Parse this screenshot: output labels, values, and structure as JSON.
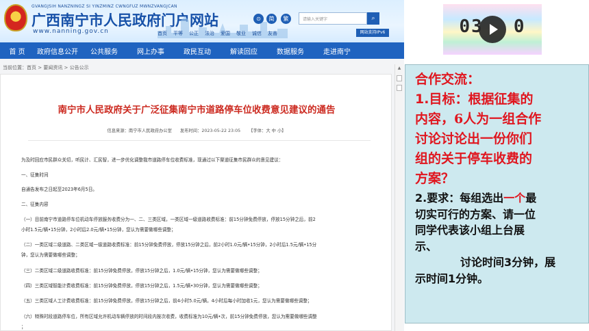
{
  "site": {
    "pinyin": "GVANGJSIH NANZNINGZ SI YINZMINZ CWNGFUZ MWNZVANGJCAN",
    "title": "广西南宁市人民政府门户网站",
    "url": "www.nanning.gov.cn",
    "header_links": [
      "首页",
      "平等",
      "公正",
      "法治",
      "爱国",
      "敬业",
      "诚信",
      "友善"
    ],
    "accessibility_label": "⊙",
    "simplified_label": "简",
    "traditional_label": "繁",
    "search_placeholder": "请输入关键字",
    "ipv6_label": "网站支持IPv6"
  },
  "nav": {
    "items": [
      "首 页",
      "政府信息公开",
      "公共服务",
      "网上办事",
      "政民互动",
      "解读回应",
      "数据服务",
      "走进南宁"
    ]
  },
  "breadcrumb": "当前位置：首页 > 要闻资讯 > 公告公示",
  "article": {
    "title": "南宁市人民政府关于广泛征集南宁市道路停车位收费意见建议的通告",
    "source": "信息来源：南宁市人民政府办公室",
    "date": "发布时间：2023-05-22 23:05",
    "font_size": "【字体：大 中 小】",
    "paragraphs": [
      "为及时回应市民群众关切，听民计、汇民智，进一步优化调整我市道路停车位收费标准，现通过以下渠道征集市民群众的意见建议：",
      "一、征集时间",
      "自通告发布之日起至2023年6月5日。",
      "二、征集内容",
      "（一）目前南宁市道路停车位机动车停放服务收费分为一、二、三类区域，一类区域一级道路收费标准：前15分钟免费停放，停放15分钟之后，前2",
      "小时1.5元/辆•15分钟，2小时后2.0元/辆•15分钟，您认为需要做哪些调整；",
      "（二）一类区域二级道路、二类区域一级道路收费标准：前15分钟免费停放，停放15分钟之后，前2小时1.0元/辆•15分钟，2小时后1.5元/辆•15分",
      "钟，您认为需要做哪些调整；",
      "（三）二类区域二级道路收费标准：前15分钟免费停放，停放15分钟之后，1.0元/辆•15分钟，您认为需要做哪些调整；",
      "（四）三类区域智能计费收费标准：前15分钟免费停放，停放15分钟之后，1.5元/辆•30分钟，您认为需要做哪些调整；",
      "（五）三类区域人工计费收费标准：前15分钟免费停放，停放15分钟之后，前4小时5.0元/辆，4小时后每小时加收1元，您认为需要做哪些调整；",
      "（六）特殊时段道路停车位，所有区域允许机动车辆停放的时间段内按次收费，收费标准为10元/辆•次，前15分钟免费停放，您认为需要做哪些调整",
      "；"
    ]
  },
  "video": {
    "time_left": "03",
    "time_right": "0"
  },
  "task": {
    "heading": "合作交流：",
    "goal_num": "1.",
    "goal_lines": [
      "目标：根据征集的",
      "内容，6人为一组合作",
      "讨论讨论出一份你们",
      "组的关于停车收费的",
      "方案？"
    ],
    "req_num": "2.",
    "req_prefix": "要求：每组选出",
    "req_red": "一个",
    "req_suffix": "最",
    "req_lines": [
      "切实可行的方案、请一位",
      "同学代表该小组上台展",
      "示、"
    ],
    "time_line1_prefix": "讨论时间",
    "time_line1_num": "3",
    "time_line1_suffix": "分钟，展",
    "time_line2_prefix": "示时间",
    "time_line2_num": "1",
    "time_line2_suffix": "分钟。"
  }
}
